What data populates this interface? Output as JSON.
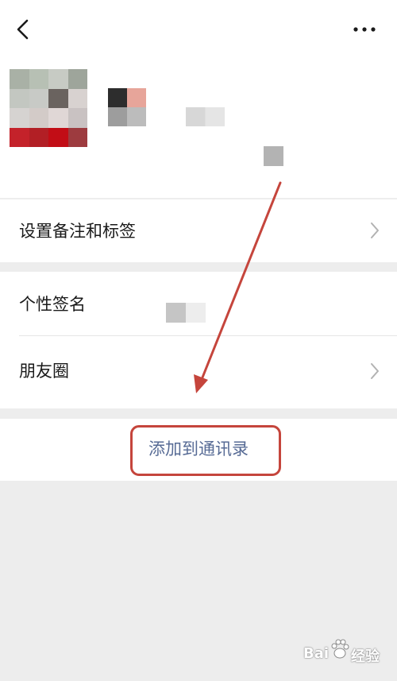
{
  "header": {
    "back_icon": "chevron-left-icon",
    "more_icon": "more-dots-icon"
  },
  "profile": {
    "avatar_mosaic_colors": [
      "#a9b1a6",
      "#b7c0b4",
      "#c7cbc4",
      "#9ea59b",
      "#c3c7c1",
      "#c8cac6",
      "#6a635f",
      "#d8d2d0",
      "#d6d3d1",
      "#d3cbc8",
      "#e0d7d6",
      "#c9c2c2",
      "#c4222a",
      "#b21f25",
      "#c20d16",
      "#9d3b3f"
    ],
    "name_mosaic_colors": [
      "#2d2d2d",
      "#e7a59a",
      "#9d9d9d",
      "#bcbcbc"
    ]
  },
  "menu": {
    "remark_label": "设置备注和标签",
    "signature_label": "个性签名",
    "moments_label": "朋友圈"
  },
  "action": {
    "add_to_contacts_label": "添加到通讯录",
    "accent_color": "#576b95",
    "annotation_color": "#c5453c"
  },
  "watermark": {
    "text_left": "Bai",
    "text_right": "经验"
  }
}
